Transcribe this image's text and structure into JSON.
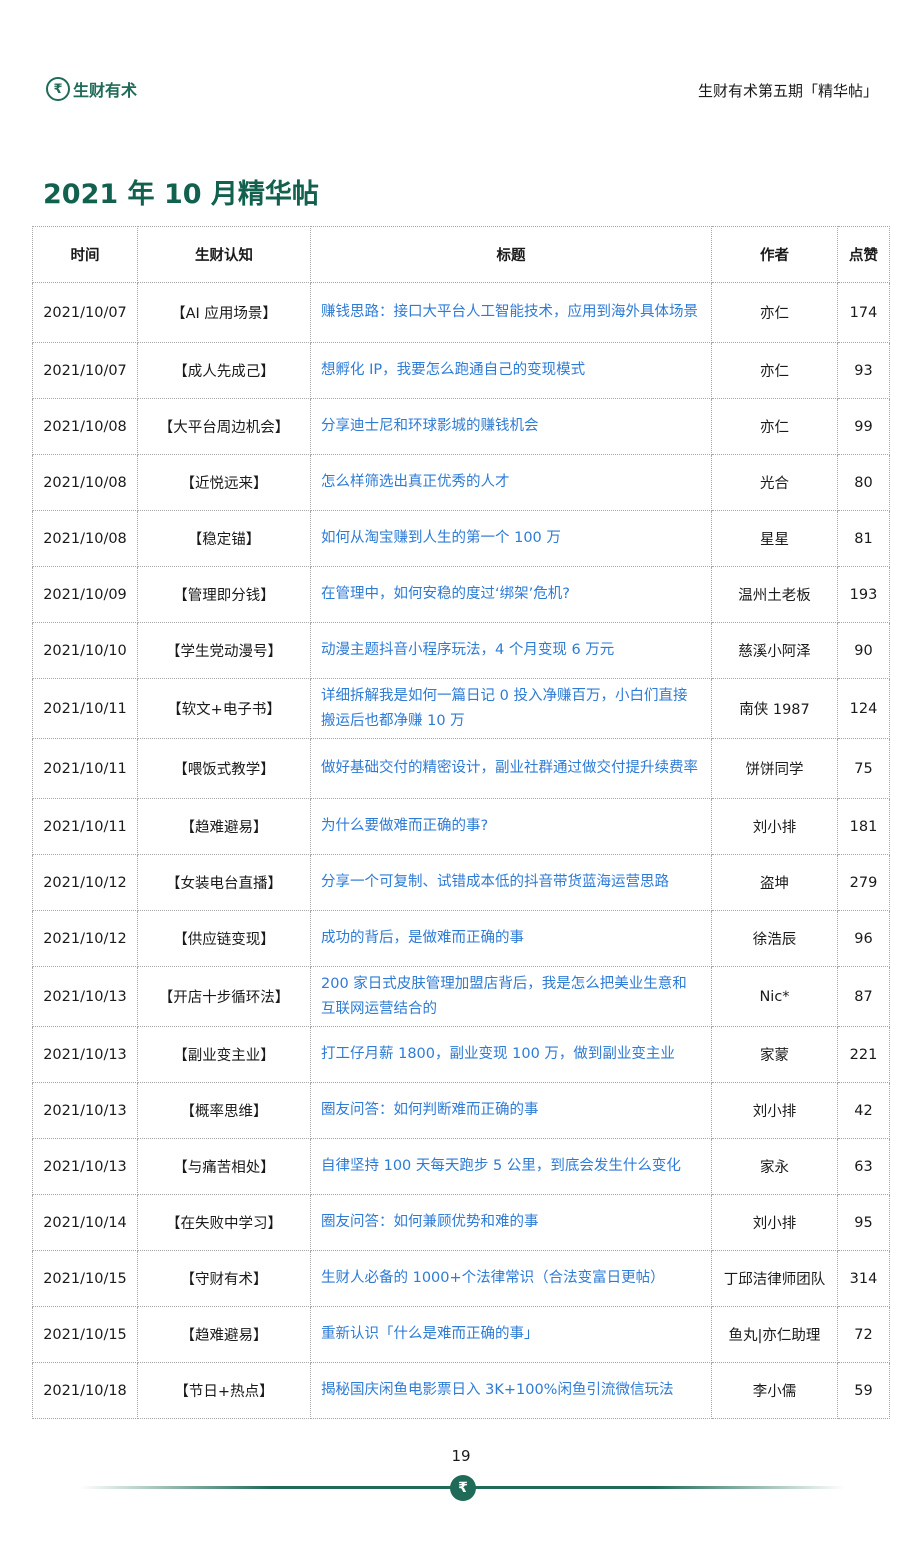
{
  "header": {
    "logo_glyph": "₹",
    "logo_text": "生财有术",
    "right_text": "生财有术第五期「精华帖」"
  },
  "page_title": "2021 年 10 月精华帖",
  "table": {
    "columns": [
      "时间",
      "生财认知",
      "标题",
      "作者",
      "点赞"
    ],
    "rows": [
      {
        "date": "2021/10/07",
        "topic": "【AI 应用场景】",
        "title": "赚钱思路：接口大平台人工智能技术，应用到海外具体场景",
        "author": "亦仁",
        "likes": "174",
        "tall": true
      },
      {
        "date": "2021/10/07",
        "topic": "【成人先成己】",
        "title": "想孵化 IP，我要怎么跑通自己的变现模式",
        "author": "亦仁",
        "likes": "93",
        "tall": false
      },
      {
        "date": "2021/10/08",
        "topic": "【大平台周边机会】",
        "title": "分享迪士尼和环球影城的赚钱机会",
        "author": "亦仁",
        "likes": "99",
        "tall": false
      },
      {
        "date": "2021/10/08",
        "topic": "【近悦远来】",
        "title": "怎么样筛选出真正优秀的人才",
        "author": "光合",
        "likes": "80",
        "tall": false
      },
      {
        "date": "2021/10/08",
        "topic": "【稳定锚】",
        "title": "如何从淘宝赚到人生的第一个 100 万",
        "author": "星星",
        "likes": "81",
        "tall": false
      },
      {
        "date": "2021/10/09",
        "topic": "【管理即分钱】",
        "title": "在管理中，如何安稳的度过‘绑架’危机?",
        "author": "温州土老板",
        "likes": "193",
        "tall": false
      },
      {
        "date": "2021/10/10",
        "topic": "【学生党动漫号】",
        "title": "动漫主题抖音小程序玩法，4 个月变现 6 万元",
        "author": "慈溪小阿泽",
        "likes": "90",
        "tall": false
      },
      {
        "date": "2021/10/11",
        "topic": "【软文+电子书】",
        "title": "详细拆解我是如何一篇日记 0 投入净赚百万，小白们直接搬运后也都净赚 10 万",
        "author": "南侠 1987",
        "likes": "124",
        "tall": true
      },
      {
        "date": "2021/10/11",
        "topic": "【喂饭式教学】",
        "title": "做好基础交付的精密设计，副业社群通过做交付提升续费率",
        "author": "饼饼同学",
        "likes": "75",
        "tall": true
      },
      {
        "date": "2021/10/11",
        "topic": "【趋难避易】",
        "title": "为什么要做难而正确的事?",
        "author": "刘小排",
        "likes": "181",
        "tall": false
      },
      {
        "date": "2021/10/12",
        "topic": "【女装电台直播】",
        "title": "分享一个可复制、试错成本低的抖音带货蓝海运营思路",
        "author": "盗坤",
        "likes": "279",
        "tall": false
      },
      {
        "date": "2021/10/12",
        "topic": "【供应链变现】",
        "title": "成功的背后，是做难而正确的事",
        "author": "徐浩辰",
        "likes": "96",
        "tall": false
      },
      {
        "date": "2021/10/13",
        "topic": "【开店十步循环法】",
        "title": "200 家日式皮肤管理加盟店背后，我是怎么把美业生意和互联网运营结合的",
        "author": "Nic*",
        "likes": "87",
        "tall": true
      },
      {
        "date": "2021/10/13",
        "topic": "【副业变主业】",
        "title": "打工仔月薪 1800，副业变现 100 万，做到副业变主业",
        "author": "家蒙",
        "likes": "221",
        "tall": false
      },
      {
        "date": "2021/10/13",
        "topic": "【概率思维】",
        "title": "圈友问答：如何判断难而正确的事",
        "author": "刘小排",
        "likes": "42",
        "tall": false
      },
      {
        "date": "2021/10/13",
        "topic": "【与痛苦相处】",
        "title": "自律坚持 100 天每天跑步 5 公里，到底会发生什么变化",
        "author": "家永",
        "likes": "63",
        "tall": false
      },
      {
        "date": "2021/10/14",
        "topic": "【在失败中学习】",
        "title": "圈友问答：如何兼顾优势和难的事",
        "author": "刘小排",
        "likes": "95",
        "tall": false
      },
      {
        "date": "2021/10/15",
        "topic": "【守财有术】",
        "title": "生财人必备的 1000+个法律常识（合法变富日更帖）",
        "author": "丁邱洁律师团队",
        "likes": "314",
        "tall": false
      },
      {
        "date": "2021/10/15",
        "topic": "【趋难避易】",
        "title": "重新认识「什么是难而正确的事」",
        "author": "鱼丸|亦仁助理",
        "likes": "72",
        "tall": false
      },
      {
        "date": "2021/10/18",
        "topic": "【节日+热点】",
        "title": "揭秘国庆闲鱼电影票日入 3K+100%闲鱼引流微信玩法",
        "author": "李小儒",
        "likes": "59",
        "tall": false
      }
    ]
  },
  "footer": {
    "page_number": "19",
    "badge_glyph": "₹"
  },
  "colors": {
    "brand_green": "#1f6b58",
    "title_green": "#12614f",
    "link_blue": "#2e7bd6"
  }
}
